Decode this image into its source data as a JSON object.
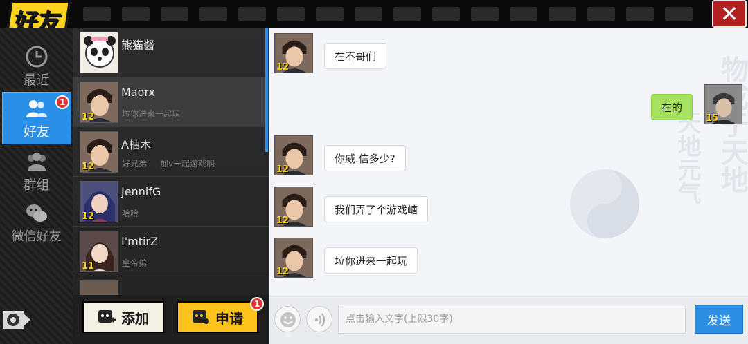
{
  "header": {
    "title": "好友",
    "close_icon": "close-x-icon"
  },
  "nav": {
    "items": [
      {
        "label": "最近",
        "icon": "clock-icon"
      },
      {
        "label": "好友",
        "icon": "friends-icon",
        "badge": "1"
      },
      {
        "label": "群组",
        "icon": "group-icon"
      },
      {
        "label": "微信好友",
        "icon": "wechat-icon"
      }
    ],
    "settings_icon": "gear-icon"
  },
  "friends": [
    {
      "name": "熊猫酱",
      "signature": "",
      "level": ""
    },
    {
      "name": "Maorx",
      "signature": "垃你进来一起玩",
      "level": "12"
    },
    {
      "name": "A柚木",
      "signature": "好兄弟     加v一起游戏啊",
      "level": "12"
    },
    {
      "name": "JennifG",
      "signature": "哈哈",
      "level": "12"
    },
    {
      "name": "I'mtirZ",
      "signature": "皇帝弟",
      "level": "11"
    }
  ],
  "list_buttons": {
    "add": "添加",
    "apply": "申请",
    "apply_badge": "1"
  },
  "messages": [
    {
      "text": "在不哥们",
      "level": "12",
      "mine": false
    },
    {
      "text": "在的",
      "level": "15",
      "mine": true
    },
    {
      "text": "你威.信多少?",
      "level": "12",
      "mine": false
    },
    {
      "text": "我们弄了个游戏嵣",
      "level": "12",
      "mine": false
    },
    {
      "text": "垃你进来一起玩",
      "level": "12",
      "mine": false
    }
  ],
  "input": {
    "placeholder": "点击输入文字(上限30字)",
    "value": ""
  },
  "send_label": "发送",
  "colors": {
    "accent": "#2a8fe6",
    "gold": "#ffc21a",
    "my_bubble": "#a6e160"
  }
}
